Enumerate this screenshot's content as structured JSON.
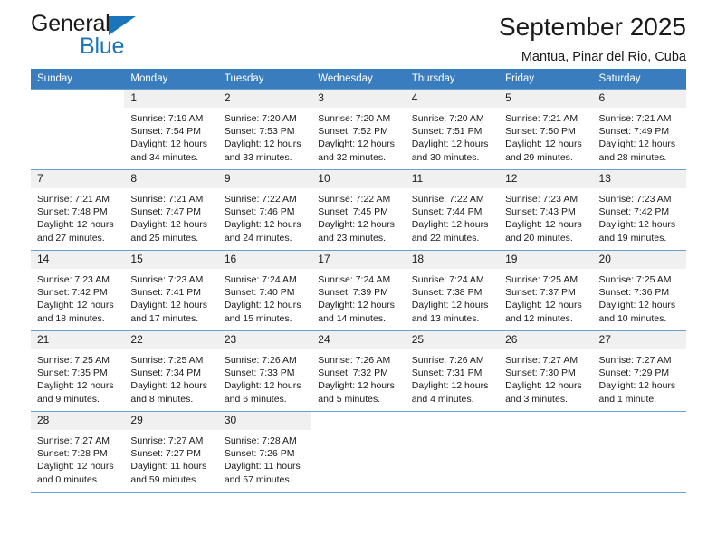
{
  "brand": {
    "line1": "General",
    "line2": "Blue",
    "triangle_color": "#1b75bb"
  },
  "header": {
    "title": "September 2025",
    "subtitle": "Mantua, Pinar del Rio, Cuba"
  },
  "theme": {
    "header_row_bg": "#3a7dbf",
    "header_row_text": "#ffffff",
    "daynum_bg": "#f0f0f0",
    "grid_line": "#6d9fcd"
  },
  "calendar": {
    "weekday_headers": [
      "Sunday",
      "Monday",
      "Tuesday",
      "Wednesday",
      "Thursday",
      "Friday",
      "Saturday"
    ],
    "weeks": [
      [
        {
          "day": "",
          "blank": true
        },
        {
          "day": "1",
          "sunrise": "Sunrise: 7:19 AM",
          "sunset": "Sunset: 7:54 PM",
          "daylight1": "Daylight: 12 hours",
          "daylight2": "and 34 minutes."
        },
        {
          "day": "2",
          "sunrise": "Sunrise: 7:20 AM",
          "sunset": "Sunset: 7:53 PM",
          "daylight1": "Daylight: 12 hours",
          "daylight2": "and 33 minutes."
        },
        {
          "day": "3",
          "sunrise": "Sunrise: 7:20 AM",
          "sunset": "Sunset: 7:52 PM",
          "daylight1": "Daylight: 12 hours",
          "daylight2": "and 32 minutes."
        },
        {
          "day": "4",
          "sunrise": "Sunrise: 7:20 AM",
          "sunset": "Sunset: 7:51 PM",
          "daylight1": "Daylight: 12 hours",
          "daylight2": "and 30 minutes."
        },
        {
          "day": "5",
          "sunrise": "Sunrise: 7:21 AM",
          "sunset": "Sunset: 7:50 PM",
          "daylight1": "Daylight: 12 hours",
          "daylight2": "and 29 minutes."
        },
        {
          "day": "6",
          "sunrise": "Sunrise: 7:21 AM",
          "sunset": "Sunset: 7:49 PM",
          "daylight1": "Daylight: 12 hours",
          "daylight2": "and 28 minutes."
        }
      ],
      [
        {
          "day": "7",
          "sunrise": "Sunrise: 7:21 AM",
          "sunset": "Sunset: 7:48 PM",
          "daylight1": "Daylight: 12 hours",
          "daylight2": "and 27 minutes."
        },
        {
          "day": "8",
          "sunrise": "Sunrise: 7:21 AM",
          "sunset": "Sunset: 7:47 PM",
          "daylight1": "Daylight: 12 hours",
          "daylight2": "and 25 minutes."
        },
        {
          "day": "9",
          "sunrise": "Sunrise: 7:22 AM",
          "sunset": "Sunset: 7:46 PM",
          "daylight1": "Daylight: 12 hours",
          "daylight2": "and 24 minutes."
        },
        {
          "day": "10",
          "sunrise": "Sunrise: 7:22 AM",
          "sunset": "Sunset: 7:45 PM",
          "daylight1": "Daylight: 12 hours",
          "daylight2": "and 23 minutes."
        },
        {
          "day": "11",
          "sunrise": "Sunrise: 7:22 AM",
          "sunset": "Sunset: 7:44 PM",
          "daylight1": "Daylight: 12 hours",
          "daylight2": "and 22 minutes."
        },
        {
          "day": "12",
          "sunrise": "Sunrise: 7:23 AM",
          "sunset": "Sunset: 7:43 PM",
          "daylight1": "Daylight: 12 hours",
          "daylight2": "and 20 minutes."
        },
        {
          "day": "13",
          "sunrise": "Sunrise: 7:23 AM",
          "sunset": "Sunset: 7:42 PM",
          "daylight1": "Daylight: 12 hours",
          "daylight2": "and 19 minutes."
        }
      ],
      [
        {
          "day": "14",
          "sunrise": "Sunrise: 7:23 AM",
          "sunset": "Sunset: 7:42 PM",
          "daylight1": "Daylight: 12 hours",
          "daylight2": "and 18 minutes."
        },
        {
          "day": "15",
          "sunrise": "Sunrise: 7:23 AM",
          "sunset": "Sunset: 7:41 PM",
          "daylight1": "Daylight: 12 hours",
          "daylight2": "and 17 minutes."
        },
        {
          "day": "16",
          "sunrise": "Sunrise: 7:24 AM",
          "sunset": "Sunset: 7:40 PM",
          "daylight1": "Daylight: 12 hours",
          "daylight2": "and 15 minutes."
        },
        {
          "day": "17",
          "sunrise": "Sunrise: 7:24 AM",
          "sunset": "Sunset: 7:39 PM",
          "daylight1": "Daylight: 12 hours",
          "daylight2": "and 14 minutes."
        },
        {
          "day": "18",
          "sunrise": "Sunrise: 7:24 AM",
          "sunset": "Sunset: 7:38 PM",
          "daylight1": "Daylight: 12 hours",
          "daylight2": "and 13 minutes."
        },
        {
          "day": "19",
          "sunrise": "Sunrise: 7:25 AM",
          "sunset": "Sunset: 7:37 PM",
          "daylight1": "Daylight: 12 hours",
          "daylight2": "and 12 minutes."
        },
        {
          "day": "20",
          "sunrise": "Sunrise: 7:25 AM",
          "sunset": "Sunset: 7:36 PM",
          "daylight1": "Daylight: 12 hours",
          "daylight2": "and 10 minutes."
        }
      ],
      [
        {
          "day": "21",
          "sunrise": "Sunrise: 7:25 AM",
          "sunset": "Sunset: 7:35 PM",
          "daylight1": "Daylight: 12 hours",
          "daylight2": "and 9 minutes."
        },
        {
          "day": "22",
          "sunrise": "Sunrise: 7:25 AM",
          "sunset": "Sunset: 7:34 PM",
          "daylight1": "Daylight: 12 hours",
          "daylight2": "and 8 minutes."
        },
        {
          "day": "23",
          "sunrise": "Sunrise: 7:26 AM",
          "sunset": "Sunset: 7:33 PM",
          "daylight1": "Daylight: 12 hours",
          "daylight2": "and 6 minutes."
        },
        {
          "day": "24",
          "sunrise": "Sunrise: 7:26 AM",
          "sunset": "Sunset: 7:32 PM",
          "daylight1": "Daylight: 12 hours",
          "daylight2": "and 5 minutes."
        },
        {
          "day": "25",
          "sunrise": "Sunrise: 7:26 AM",
          "sunset": "Sunset: 7:31 PM",
          "daylight1": "Daylight: 12 hours",
          "daylight2": "and 4 minutes."
        },
        {
          "day": "26",
          "sunrise": "Sunrise: 7:27 AM",
          "sunset": "Sunset: 7:30 PM",
          "daylight1": "Daylight: 12 hours",
          "daylight2": "and 3 minutes."
        },
        {
          "day": "27",
          "sunrise": "Sunrise: 7:27 AM",
          "sunset": "Sunset: 7:29 PM",
          "daylight1": "Daylight: 12 hours",
          "daylight2": "and 1 minute."
        }
      ],
      [
        {
          "day": "28",
          "sunrise": "Sunrise: 7:27 AM",
          "sunset": "Sunset: 7:28 PM",
          "daylight1": "Daylight: 12 hours",
          "daylight2": "and 0 minutes."
        },
        {
          "day": "29",
          "sunrise": "Sunrise: 7:27 AM",
          "sunset": "Sunset: 7:27 PM",
          "daylight1": "Daylight: 11 hours",
          "daylight2": "and 59 minutes."
        },
        {
          "day": "30",
          "sunrise": "Sunrise: 7:28 AM",
          "sunset": "Sunset: 7:26 PM",
          "daylight1": "Daylight: 11 hours",
          "daylight2": "and 57 minutes."
        },
        {
          "day": "",
          "blank": true
        },
        {
          "day": "",
          "blank": true
        },
        {
          "day": "",
          "blank": true
        },
        {
          "day": "",
          "blank": true
        }
      ]
    ]
  }
}
